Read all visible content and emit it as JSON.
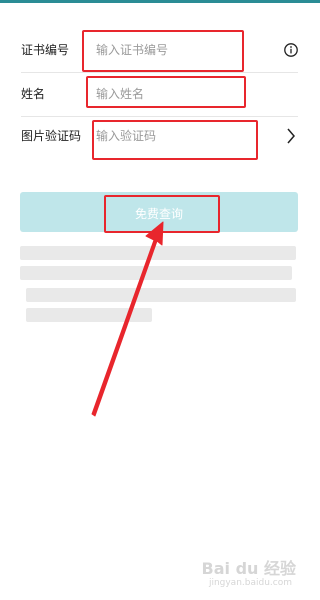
{
  "form": {
    "fields": [
      {
        "label": "证书编号",
        "placeholder": "输入证书编号"
      },
      {
        "label": "姓名",
        "placeholder": "输入姓名"
      },
      {
        "label": "图片验证码",
        "placeholder": "输入验证码"
      }
    ]
  },
  "query_button": {
    "label": "免费查询"
  },
  "icons": {
    "info": "info-circle-icon",
    "chevron": "chevron-right-icon"
  },
  "colors": {
    "accent": "#2a8c95",
    "button": "#bfe6ea",
    "annotation": "#e8262d"
  },
  "watermark": {
    "brand": "Bai du 经验",
    "domain": "jingyan.baidu.com"
  }
}
